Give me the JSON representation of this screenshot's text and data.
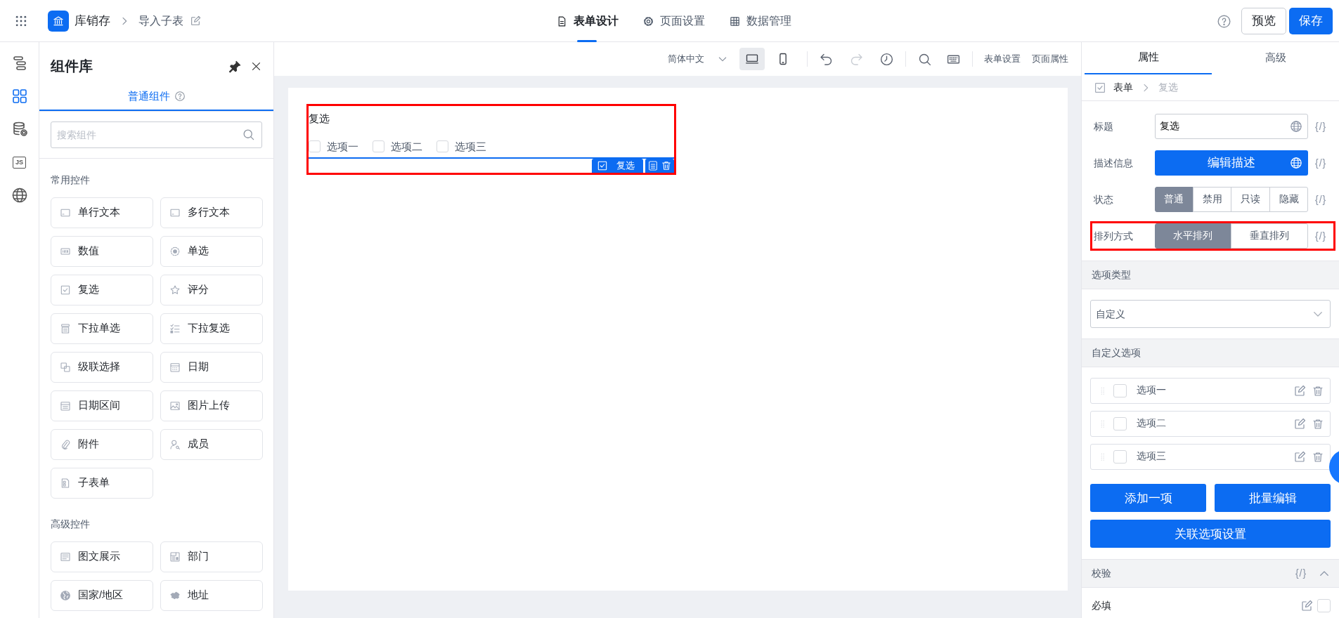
{
  "header": {
    "app_name": "库销存",
    "page_name": "导入子表",
    "tabs": [
      {
        "kind": "doc",
        "label": "表单设计",
        "selected": true
      },
      {
        "kind": "gear",
        "label": "页面设置",
        "selected": false
      },
      {
        "kind": "table",
        "label": "数据管理",
        "selected": false
      }
    ],
    "buttons": [
      {
        "label": "预览",
        "kind": "outline"
      },
      {
        "label": "保存",
        "kind": "primary"
      }
    ]
  },
  "rail": [
    {
      "kind": "outline",
      "selected": false
    },
    {
      "kind": "components",
      "selected": true
    },
    {
      "kind": "database",
      "selected": false
    },
    {
      "kind": "js",
      "label": "JS",
      "selected": false
    },
    {
      "kind": "globe",
      "selected": false
    }
  ],
  "component_panel": {
    "title": "组件库",
    "tabs": [
      {
        "label": "普通组件",
        "selected": true
      }
    ],
    "search": {
      "placeholder": "搜索组件"
    },
    "groups": [
      {
        "title": "常用控件",
        "items": [
          {
            "kind": "input",
            "label": "单行文本"
          },
          {
            "kind": "input",
            "label": "多行文本"
          },
          {
            "kind": "number",
            "label": "数值"
          },
          {
            "kind": "radio",
            "label": "单选"
          },
          {
            "kind": "checkbox",
            "label": "复选"
          },
          {
            "kind": "star",
            "label": "评分"
          },
          {
            "kind": "select",
            "label": "下拉单选"
          },
          {
            "kind": "multiselect",
            "label": "下拉复选"
          },
          {
            "kind": "cascade",
            "label": "级联选择"
          },
          {
            "kind": "date",
            "label": "日期"
          },
          {
            "kind": "daterange",
            "label": "日期区间"
          },
          {
            "kind": "image",
            "label": "图片上传"
          },
          {
            "kind": "attachment",
            "label": "附件"
          },
          {
            "kind": "member",
            "label": "成员"
          },
          {
            "kind": "subform",
            "label": "子表单"
          }
        ]
      },
      {
        "title": "高级控件",
        "items": [
          {
            "kind": "richtext",
            "label": "图文展示"
          },
          {
            "kind": "department",
            "label": "部门"
          },
          {
            "kind": "globe",
            "label": "国家/地区"
          },
          {
            "kind": "map",
            "label": "地址"
          }
        ]
      }
    ]
  },
  "toolbar": {
    "language": "简体中文",
    "devices": [
      {
        "kind": "desktop",
        "selected": true
      },
      {
        "kind": "mobile",
        "selected": false
      }
    ],
    "actions": [
      {
        "kind": "undo",
        "disabled": false
      },
      {
        "kind": "redo",
        "disabled": true
      },
      {
        "kind": "history",
        "disabled": false
      }
    ],
    "tools": [
      {
        "kind": "search"
      },
      {
        "kind": "keyboard"
      }
    ],
    "links": [
      "表单设置",
      "页面属性"
    ]
  },
  "canvas": {
    "fields": [
      {
        "label": "复选",
        "selected": true,
        "highlighted": true,
        "tag": "复选",
        "options": [
          {
            "label": "选项一",
            "checked": false
          },
          {
            "label": "选项二",
            "checked": false
          },
          {
            "label": "选项三",
            "checked": false
          }
        ]
      }
    ]
  },
  "properties": {
    "tabs": [
      {
        "label": "属性",
        "selected": true
      },
      {
        "label": "高级",
        "selected": false
      }
    ],
    "breadcrumb": [
      "表单",
      "复选"
    ],
    "rows": [
      {
        "kind": "input",
        "label": "标题",
        "value": "复选",
        "binding": "{/}"
      },
      {
        "kind": "button",
        "label": "描述信息",
        "button": "编辑描述",
        "binding": "{/}"
      },
      {
        "kind": "segmented",
        "label": "状态",
        "binding": "{/}",
        "options": [
          {
            "label": "普通",
            "selected": true
          },
          {
            "label": "禁用",
            "selected": false
          },
          {
            "label": "只读",
            "selected": false
          },
          {
            "label": "隐藏",
            "selected": false
          }
        ]
      },
      {
        "kind": "segmented",
        "label": "排列方式",
        "binding": "{/}",
        "highlighted": true,
        "options": [
          {
            "label": "水平排列",
            "selected": true
          },
          {
            "label": "垂直排列",
            "selected": false
          }
        ]
      }
    ],
    "option_type": {
      "title": "选项类型",
      "value": "自定义"
    },
    "custom_options": {
      "title": "自定义选项",
      "items": [
        {
          "label": "选项一",
          "checked": false
        },
        {
          "label": "选项二",
          "checked": false
        },
        {
          "label": "选项三",
          "checked": false
        }
      ],
      "buttons": [
        "添加一项",
        "批量编辑",
        "关联选项设置"
      ]
    },
    "validation": {
      "title": "校验",
      "binding": "{/}",
      "expanded": true,
      "rules": [
        {
          "label": "必填",
          "checked": false
        }
      ]
    }
  }
}
